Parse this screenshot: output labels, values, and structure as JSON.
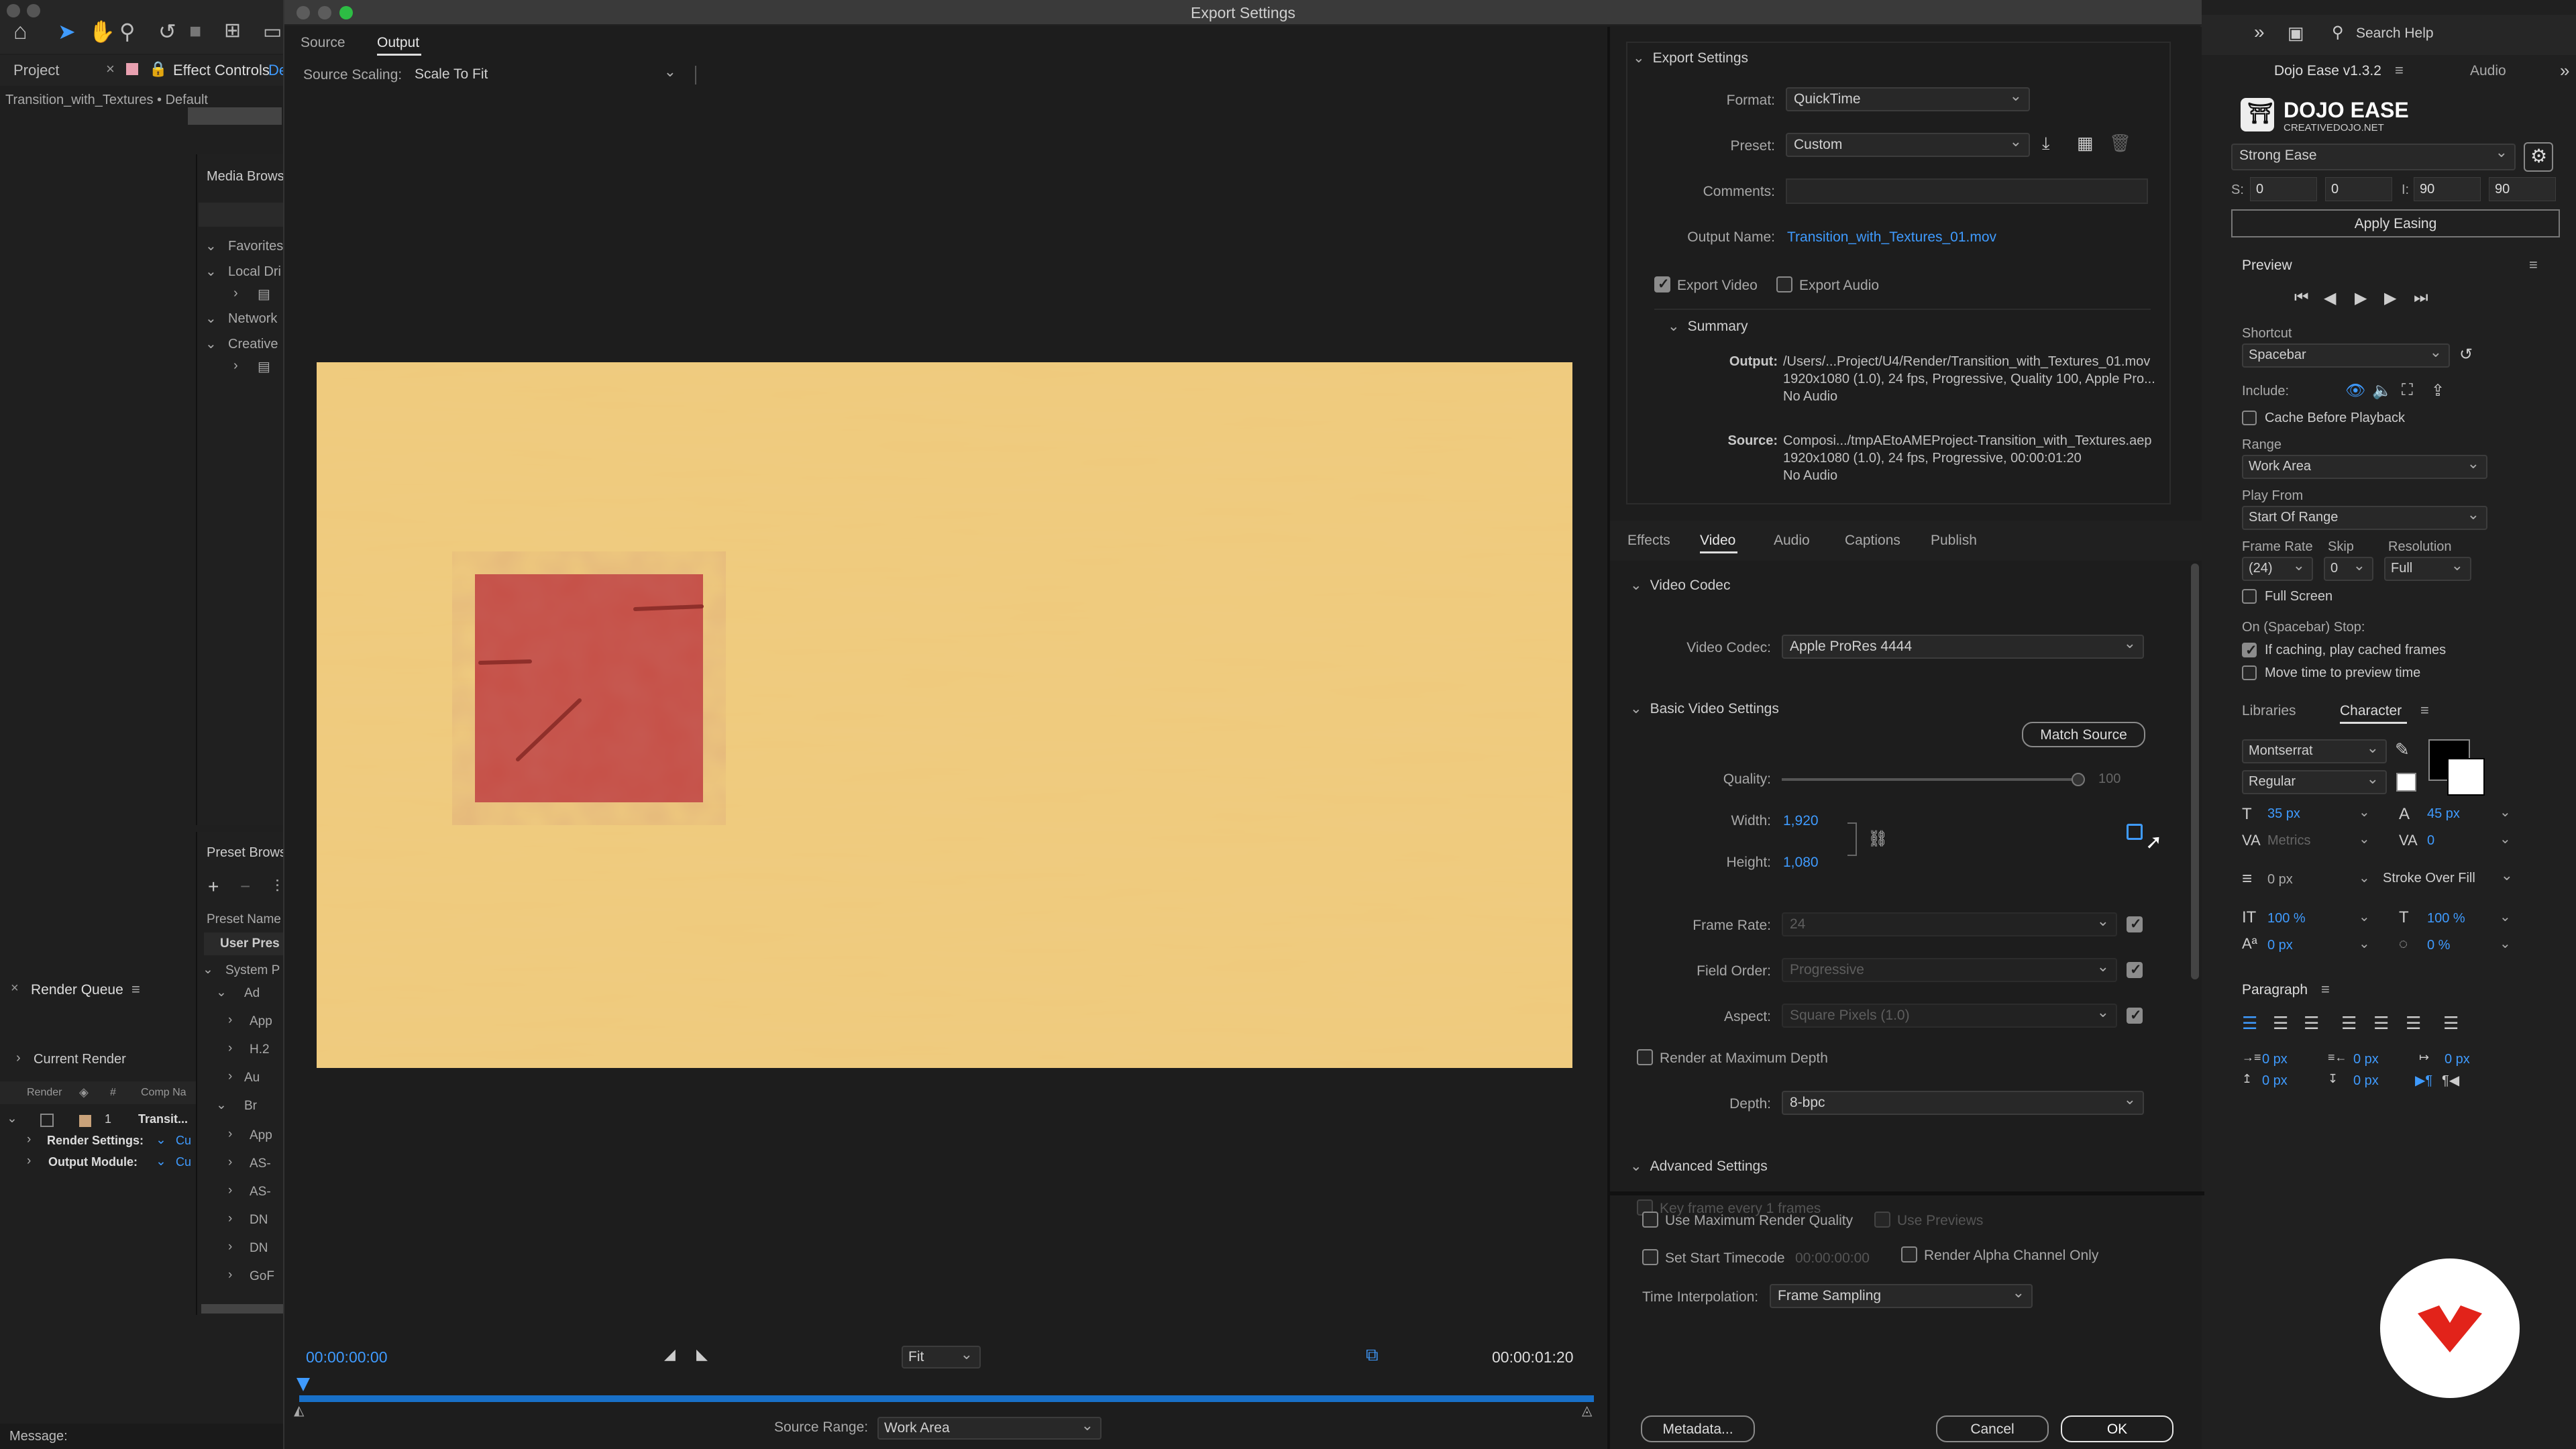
{
  "dialog": {
    "title": "Export Settings",
    "left_tabs": [
      "Source",
      "Output"
    ],
    "source_scaling_label": "Source Scaling:",
    "source_scaling_value": "Scale To Fit",
    "timecode_start": "00:00:00:00",
    "timecode_end": "00:00:01:20",
    "fit_value": "Fit",
    "source_range_label": "Source Range:",
    "source_range_value": "Work Area",
    "export_settings": {
      "header": "Export Settings",
      "format_label": "Format:",
      "format_value": "QuickTime",
      "preset_label": "Preset:",
      "preset_value": "Custom",
      "comments_label": "Comments:",
      "output_name_label": "Output Name:",
      "output_name_value": "Transition_with_Textures_01.mov",
      "export_video_label": "Export Video",
      "export_audio_label": "Export Audio",
      "summary_header": "Summary",
      "output_label": "Output:",
      "output_line1": "/Users/...Project/U4/Render/Transition_with_Textures_01.mov",
      "output_line2": "1920x1080 (1.0), 24 fps, Progressive, Quality 100, Apple Pro...",
      "output_line3": "No Audio",
      "source_label": "Source:",
      "source_line1": "Composi.../tmpAEtoAMEProject-Transition_with_Textures.aep",
      "source_line2": "1920x1080 (1.0), 24 fps, Progressive, 00:00:01:20",
      "source_line3": "No Audio"
    },
    "tabs": [
      "Effects",
      "Video",
      "Audio",
      "Captions",
      "Publish"
    ],
    "video": {
      "codec_header": "Video Codec",
      "codec_label": "Video Codec:",
      "codec_value": "Apple ProRes 4444",
      "basic_header": "Basic Video Settings",
      "match_source": "Match Source",
      "quality_label": "Quality:",
      "quality_value": "100",
      "width_label": "Width:",
      "width_value": "1,920",
      "height_label": "Height:",
      "height_value": "1,080",
      "frame_rate_label": "Frame Rate:",
      "frame_rate_value": "24",
      "field_order_label": "Field Order:",
      "field_order_value": "Progressive",
      "aspect_label": "Aspect:",
      "aspect_value": "Square Pixels (1.0)",
      "max_depth_label": "Render at Maximum Depth",
      "depth_label": "Depth:",
      "depth_value": "8-bpc",
      "advanced_header": "Advanced Settings",
      "keyframe_label": "Key frame every  1 frames"
    },
    "bottom": {
      "max_quality_label": "Use Maximum Render Quality",
      "use_previews_label": "Use Previews",
      "start_tc_label": "Set Start Timecode",
      "start_tc_value": "00:00:00:00",
      "alpha_label": "Render Alpha Channel Only",
      "interp_label": "Time Interpolation:",
      "interp_value": "Frame Sampling",
      "metadata_btn": "Metadata...",
      "cancel_btn": "Cancel",
      "ok_btn": "OK"
    }
  },
  "ae_left": {
    "project_tab": "Project",
    "effect_controls_tab": "Effect Controls",
    "effect_controls_suffix": "De",
    "comp_line": "Transition_with_Textures • Default",
    "media_browser": "Media Brows",
    "favorites": "Favorites",
    "local_drives": "Local Dri",
    "network": "Network",
    "creative": "Creative",
    "preset_browser": "Preset Brows",
    "preset_name": "Preset Name",
    "user_presets": "User Pres",
    "system_presets": "System P",
    "preset_rows": [
      "Ad",
      "App",
      "H.2",
      "Au",
      "Br",
      "App",
      "AS-",
      "AS-",
      "DN",
      "DN",
      "GoF"
    ],
    "render_queue": "Render Queue",
    "current_render": "Current Render",
    "rq_cols": [
      "Render",
      "#",
      "Comp Na"
    ],
    "rq_index": "1",
    "rq_item": "Transit...",
    "render_settings": "Render Settings:",
    "output_module": "Output Module:",
    "cu": "Cu",
    "message": "Message:"
  },
  "ae_right": {
    "search_help": "Search Help",
    "dojo_tab": "Dojo Ease v1.3.2",
    "audio_tab": "Audio",
    "dojo_title": "DOJO EASE",
    "dojo_sub": "CREATIVEDOJO.NET",
    "ease_value": "Strong Ease",
    "s_label": "S:",
    "s1": "0",
    "s2": "0",
    "i_label": "I:",
    "i1": "90",
    "i2": "90",
    "apply_easing": "Apply Easing",
    "preview_header": "Preview",
    "shortcut_label": "Shortcut",
    "shortcut_value": "Spacebar",
    "include_label": "Include:",
    "cache_label": "Cache Before Playback",
    "range_label": "Range",
    "range_value": "Work Area",
    "play_from_label": "Play From",
    "play_from_value": "Start Of Range",
    "frame_rate_label": "Frame Rate",
    "skip_label": "Skip",
    "resolution_label": "Resolution",
    "frame_rate_value": "(24)",
    "skip_value": "0",
    "resolution_value": "Full",
    "full_screen": "Full Screen",
    "on_stop": "On (Spacebar) Stop:",
    "if_caching": "If caching, play cached frames",
    "move_time": "Move time to preview time",
    "libraries_tab": "Libraries",
    "character_tab": "Character",
    "font_value": "Montserrat",
    "style_value": "Regular",
    "font_size": "35 px",
    "leading": "45 px",
    "kerning": "Metrics",
    "tracking": "0",
    "stroke_px": "0 px",
    "stroke_type": "Stroke Over Fill",
    "vscale": "100 %",
    "hscale": "100 %",
    "baseline": "0 px",
    "tsume": "0 %",
    "paragraph_header": "Paragraph",
    "para_values": [
      "0 px",
      "0 px",
      "0 px",
      "0 px",
      "0 px"
    ]
  },
  "colors": {
    "canvas_bg": "#efca7c",
    "square": "#c64f46",
    "accent_blue": "#3f9bff",
    "logo_red": "#e2231a"
  }
}
